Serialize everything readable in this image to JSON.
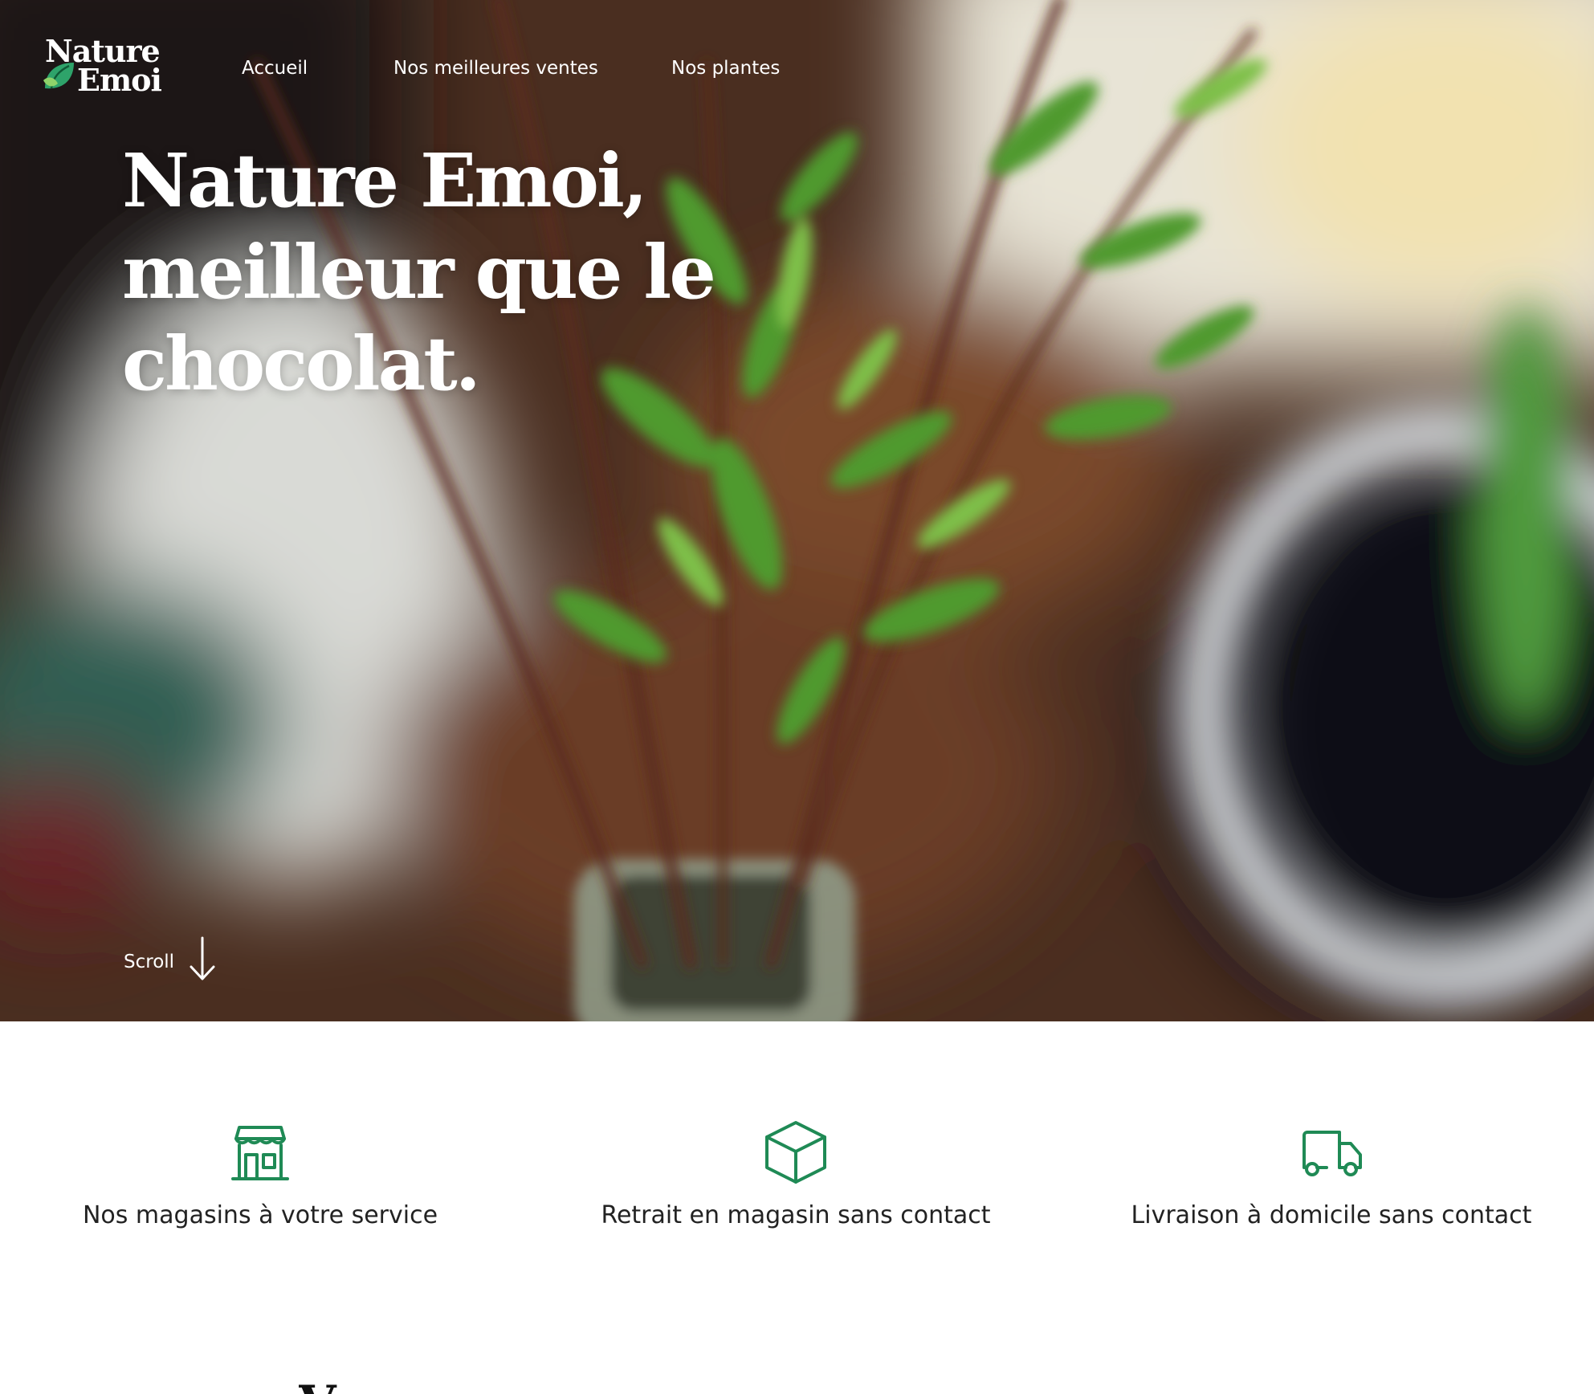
{
  "brand": {
    "logo_line1": "Nature",
    "logo_line2": "Emoi",
    "accent_color": "#1f8a55"
  },
  "nav": {
    "items": [
      {
        "label": "Accueil"
      },
      {
        "label": "Nos meilleures ventes"
      },
      {
        "label": "Nos plantes"
      }
    ]
  },
  "hero": {
    "title_line1": "Nature Emoi,",
    "title_line2": "meilleur que le",
    "title_line3": "chocolat.",
    "scroll_label": "Scroll",
    "scroll_icon": "arrow-down-icon"
  },
  "features": [
    {
      "label": "Nos magasins à votre service",
      "icon": "store-icon"
    },
    {
      "label": "Retrait en magasin sans contact",
      "icon": "box-icon"
    },
    {
      "label": "Livraison à domicile sans contact",
      "icon": "truck-icon"
    }
  ],
  "next_section": {
    "title_fragment": "Ve"
  }
}
